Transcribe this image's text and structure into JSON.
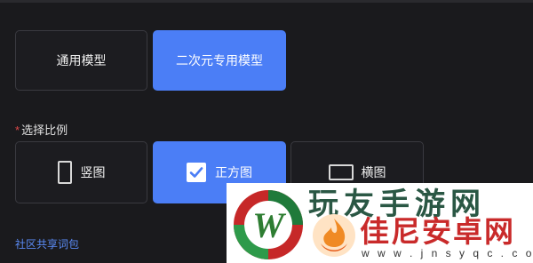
{
  "model": {
    "options": [
      {
        "label": "通用模型",
        "active": false
      },
      {
        "label": "二次元专用模型",
        "active": true
      }
    ]
  },
  "ratio": {
    "required_mark": "*",
    "label": "选择比例",
    "options": [
      {
        "label": "竖图",
        "icon": "portrait-icon",
        "active": false
      },
      {
        "label": "正方图",
        "icon": "check-icon",
        "active": true
      },
      {
        "label": "横图",
        "icon": "landscape-icon",
        "active": false
      }
    ]
  },
  "community": {
    "label": "社区共享词包"
  },
  "watermark": {
    "ghost_text": "玩友手游网",
    "title": "佳尼安卓网",
    "url": "w w w . j n s y q c . c o m",
    "logo_letter": "W"
  },
  "colors": {
    "accent": "#4b7ef6",
    "background": "#1a1a1d",
    "required": "#e04a4a",
    "link": "#5b8cf7"
  }
}
